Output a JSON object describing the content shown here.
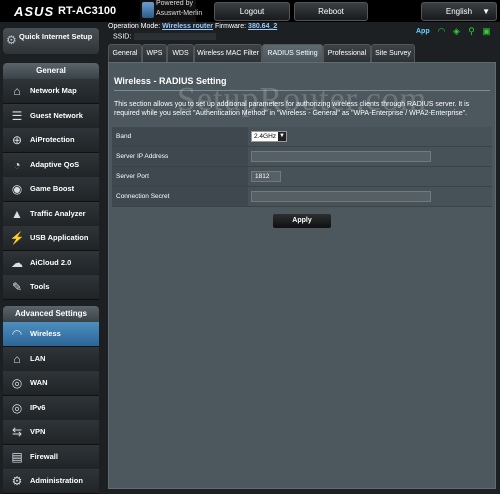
{
  "header": {
    "brand": "ASUS",
    "model": "RT-AC3100",
    "powered_by_line1": "Powered by",
    "powered_by_line2": "Asuswrt-Merlin",
    "logout_label": "Logout",
    "reboot_label": "Reboot",
    "language_label": "English",
    "operation_mode_label": "Operation Mode:",
    "operation_mode_value": "Wireless router",
    "firmware_label": "Firmware:",
    "firmware_value": "380.64_2",
    "ssid_label": "SSID:",
    "app_label": "App"
  },
  "sidebar": {
    "quick_setup_label": "Quick Internet Setup",
    "general_header": "General",
    "general_items": [
      {
        "label": "Network Map",
        "icon": "network-map-icon"
      },
      {
        "label": "Guest Network",
        "icon": "guest-network-icon"
      },
      {
        "label": "AiProtection",
        "icon": "aiprotection-icon"
      },
      {
        "label": "Adaptive QoS",
        "icon": "qos-icon"
      },
      {
        "label": "Game Boost",
        "icon": "gamepad-icon"
      },
      {
        "label": "Traffic Analyzer",
        "icon": "traffic-analyzer-icon"
      },
      {
        "label": "USB Application",
        "icon": "usb-icon"
      },
      {
        "label": "AiCloud 2.0",
        "icon": "cloud-icon"
      },
      {
        "label": "Tools",
        "icon": "wrench-icon"
      }
    ],
    "advanced_header": "Advanced Settings",
    "advanced_items": [
      {
        "label": "Wireless",
        "icon": "wireless-icon",
        "selected": true
      },
      {
        "label": "LAN",
        "icon": "lan-icon"
      },
      {
        "label": "WAN",
        "icon": "wan-globe-icon"
      },
      {
        "label": "IPv6",
        "icon": "ipv6-globe-icon"
      },
      {
        "label": "VPN",
        "icon": "vpn-icon"
      },
      {
        "label": "Firewall",
        "icon": "firewall-icon"
      },
      {
        "label": "Administration",
        "icon": "administration-icon"
      }
    ]
  },
  "tabs": [
    {
      "label": "General"
    },
    {
      "label": "WPS"
    },
    {
      "label": "WDS"
    },
    {
      "label": "Wireless MAC Filter"
    },
    {
      "label": "RADIUS Setting",
      "selected": true
    },
    {
      "label": "Professional"
    },
    {
      "label": "Site Survey"
    }
  ],
  "main": {
    "title": "Wireless - RADIUS Setting",
    "description": "This section allows you to set up additional parameters for authorizing wireless clients through RADIUS server. It is required while you select \"Authentication Method\" in \"Wireless - General\" as \"WPA-Enterprise / WPA2-Enterprise\".",
    "watermark": "SetupRouter.com",
    "fields": {
      "band_label": "Band",
      "band_value": "2.4GHz",
      "server_ip_label": "Server IP Address",
      "server_ip_value": "",
      "server_port_label": "Server Port",
      "server_port_value": "1812",
      "secret_label": "Connection Secret",
      "secret_value": ""
    },
    "apply_label": "Apply"
  },
  "colors": {
    "accent": "#2c6596",
    "panel": "#4d585e",
    "link": "#9dcbff"
  }
}
